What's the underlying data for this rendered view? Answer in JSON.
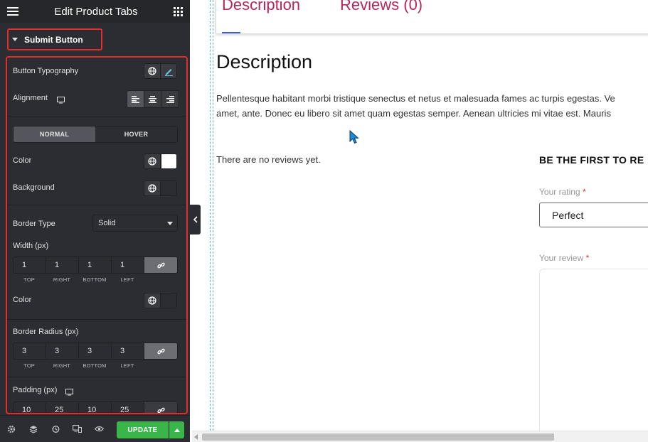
{
  "editor": {
    "title": "Edit Product Tabs",
    "section_title": "Submit Button",
    "typography_label": "Button Typography",
    "alignment_label": "Alignment",
    "state_tabs": {
      "normal": "NORMAL",
      "hover": "HOVER"
    },
    "color_label": "Color",
    "background_label": "Background",
    "border_type_label": "Border Type",
    "border_type_value": "Solid",
    "width_label": "Width (px)",
    "width_values": {
      "top": "1",
      "right": "1",
      "bottom": "1",
      "left": "1"
    },
    "dim_labels": {
      "top": "TOP",
      "right": "RIGHT",
      "bottom": "BOTTOM",
      "left": "LEFT"
    },
    "border_color_label": "Color",
    "radius_label": "Border Radius (px)",
    "radius_values": {
      "top": "3",
      "right": "3",
      "bottom": "3",
      "left": "3"
    },
    "padding_label": "Padding (px)",
    "padding_values": {
      "top": "10",
      "right": "25",
      "bottom": "10",
      "left": "25"
    },
    "update_label": "UPDATE"
  },
  "colors": {
    "accent_red": "#e22b2b",
    "update_green": "#39b54a",
    "tab_text": "#b5265b",
    "panel_bg": "#2c2d33"
  },
  "preview": {
    "tab_description": "Description",
    "tab_reviews": "Reviews (0)",
    "heading": "Description",
    "body_line1": "Pellentesque habitant morbi tristique senectus et netus et malesuada fames ac turpis egestas. Ve",
    "body_line2": "amet, ante. Donec eu libero sit amet quam egestas semper. Aenean ultricies mi vitae est. Mauris",
    "no_reviews": "There are no reviews yet.",
    "first_review": "BE THE FIRST TO RE",
    "rating_label": "Your rating",
    "rating_value": "Perfect",
    "review_label": "Your review",
    "required_mark": "*"
  }
}
